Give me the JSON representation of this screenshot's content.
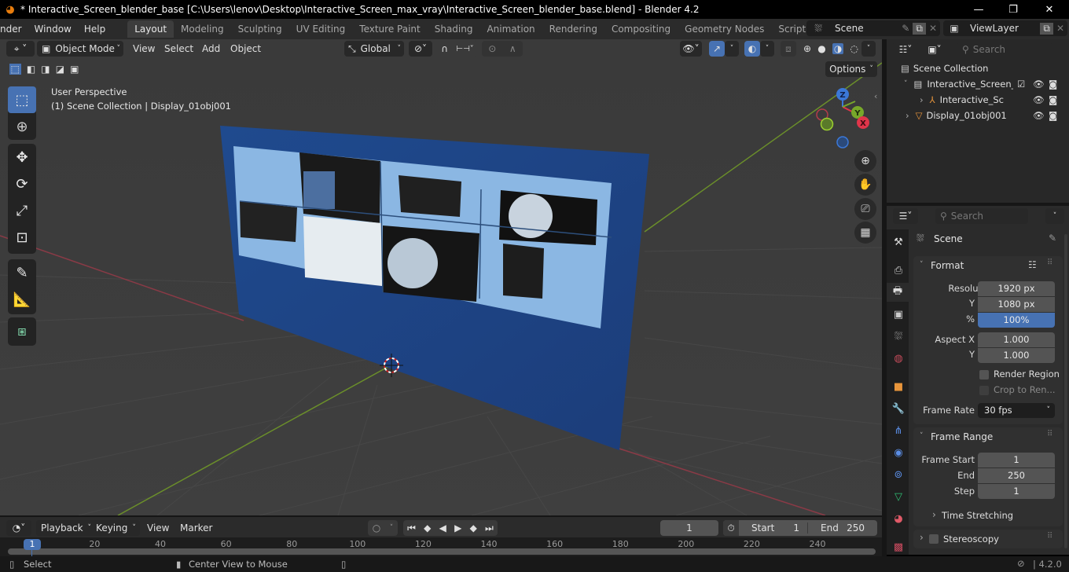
{
  "window": {
    "title": "* Interactive_Screen_blender_base [C:\\Users\\lenov\\Desktop\\Interactive_Screen_max_vray\\Interactive_Screen_blender_base.blend] - Blender 4.2",
    "minimize": "—",
    "maximize": "❐",
    "close": "✕"
  },
  "menubar": {
    "items": [
      "nder",
      "Window",
      "Help"
    ],
    "workspaces": [
      "Layout",
      "Modeling",
      "Sculpting",
      "UV Editing",
      "Texture Paint",
      "Shading",
      "Animation",
      "Rendering",
      "Compositing",
      "Geometry Nodes",
      "Scripting"
    ],
    "active_workspace": "Layout",
    "add_workspace": "+",
    "scene": "Scene",
    "view_layer": "ViewLayer"
  },
  "viewport": {
    "mode": "Object Mode",
    "menus": [
      "View",
      "Select",
      "Add",
      "Object"
    ],
    "transform_orientation": "Global",
    "options_label": "Options",
    "view_name": "User Perspective",
    "context_info": "(1) Scene Collection | Display_01obj001",
    "gizmo_axes": [
      "Z",
      "Y",
      "X"
    ],
    "accent_blue": "#4772b3"
  },
  "outliner": {
    "search_placeholder": "Search",
    "rows": [
      {
        "label": "Scene Collection"
      },
      {
        "label": "Interactive_Screen_"
      },
      {
        "label": "Interactive_Scr"
      },
      {
        "label": "Display_01obj001"
      }
    ]
  },
  "properties": {
    "search_placeholder": "Search",
    "context": "Scene",
    "format": {
      "title": "Format",
      "resolution_x_label": "Resolutio...",
      "resolution_x": "1920 px",
      "resolution_y_label": "Y",
      "resolution_y": "1080 px",
      "percent_label": "%",
      "percent": "100%",
      "aspect_x_label": "Aspect X",
      "aspect_x": "1.000",
      "aspect_y_label": "Y",
      "aspect_y": "1.000",
      "render_region": "Render Region",
      "crop_to_render": "Crop to Ren...",
      "frame_rate_label": "Frame Rate",
      "frame_rate": "30 fps"
    },
    "frame_range": {
      "title": "Frame Range",
      "start_label": "Frame Start",
      "start": "1",
      "end_label": "End",
      "end": "250",
      "step_label": "Step",
      "step": "1",
      "time_stretching": "Time Stretching"
    },
    "stereoscopy": "Stereoscopy"
  },
  "timeline": {
    "menus": [
      "Playback",
      "Keying",
      "View",
      "Marker"
    ],
    "current_frame": "1",
    "start_label": "Start",
    "start": "1",
    "end_label": "End",
    "end": "250",
    "playhead": "1",
    "ticks": [
      "20",
      "40",
      "60",
      "80",
      "100",
      "120",
      "140",
      "160",
      "180",
      "200",
      "220",
      "240"
    ]
  },
  "statusbar": {
    "select": "Select",
    "center_view": "Center View to Mouse",
    "version": "4.2.0"
  }
}
